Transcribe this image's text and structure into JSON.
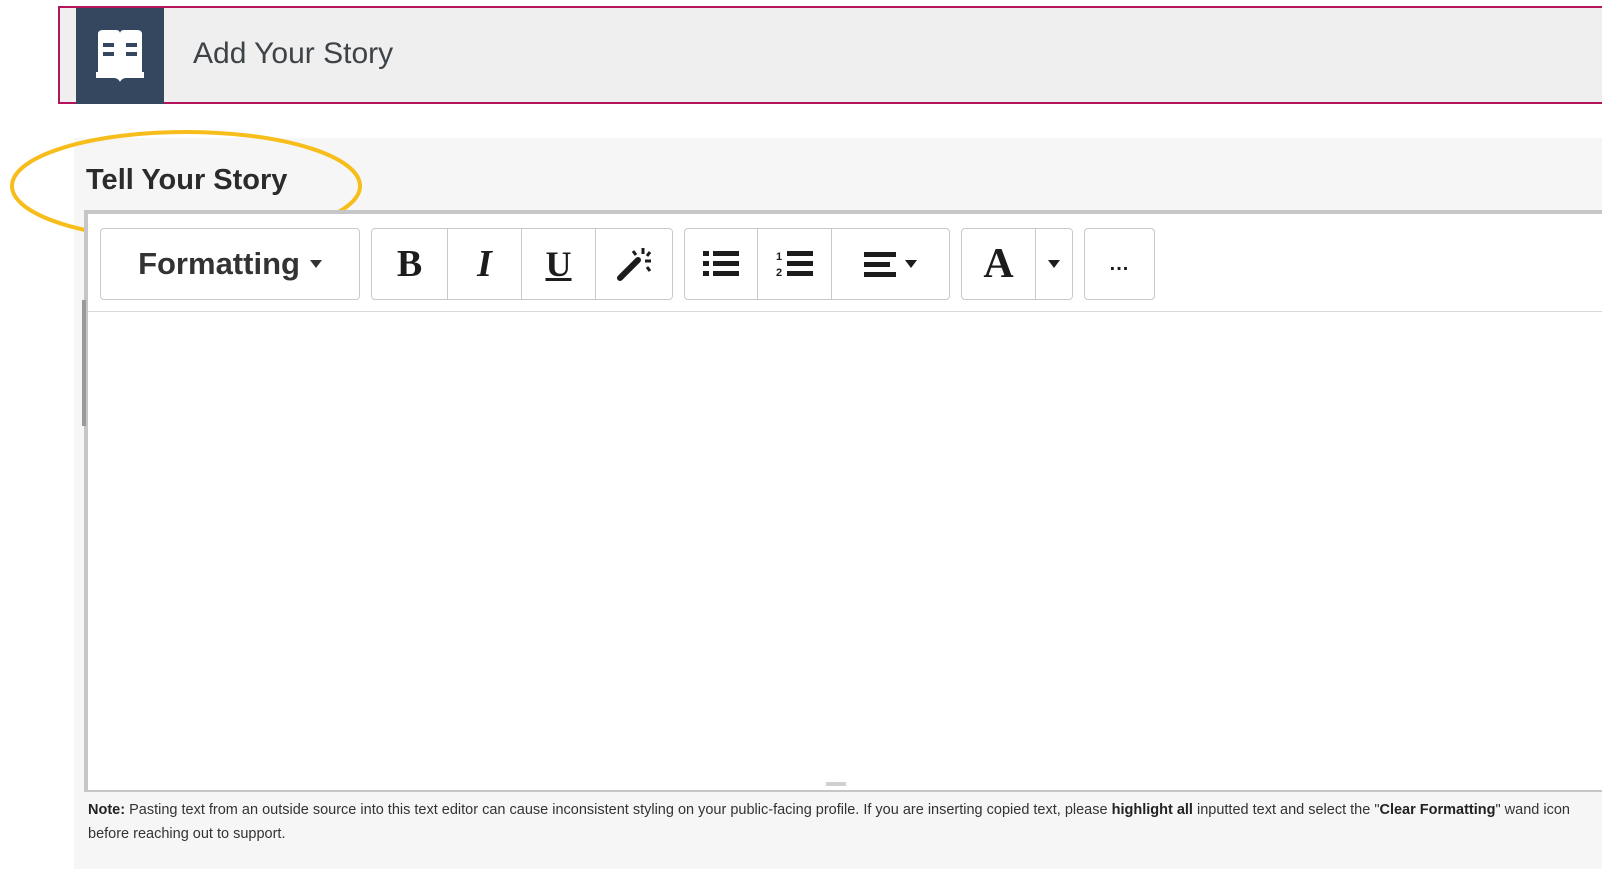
{
  "header": {
    "title": "Add Your Story",
    "icon": "open-book-icon",
    "border_color": "#b4145a",
    "icon_bg": "#34475f"
  },
  "section": {
    "heading": "Tell Your Story",
    "highlight_color": "#f7bd1b"
  },
  "toolbar": {
    "formatting_label": "Formatting",
    "bold_label": "B",
    "italic_label": "I",
    "underline_label": "U",
    "clear_formatting_icon": "magic-wand-icon",
    "bullet_list_icon": "bulleted-list-icon",
    "numbered_list_icon": "numbered-list-icon",
    "align_icon": "align-left-icon",
    "font_color_label": "A",
    "more_label": "..."
  },
  "editor": {
    "content": ""
  },
  "note": {
    "lead": "Note:",
    "text1": " Pasting text from an outside source into this text editor can cause inconsistent styling on your public-facing profile. If you are inserting copied text, please ",
    "bold1": "highlight all",
    "text2": " inputted text and select the \"",
    "bold2": "Clear Formatting",
    "text3": "\" wand icon before reaching out to support."
  }
}
